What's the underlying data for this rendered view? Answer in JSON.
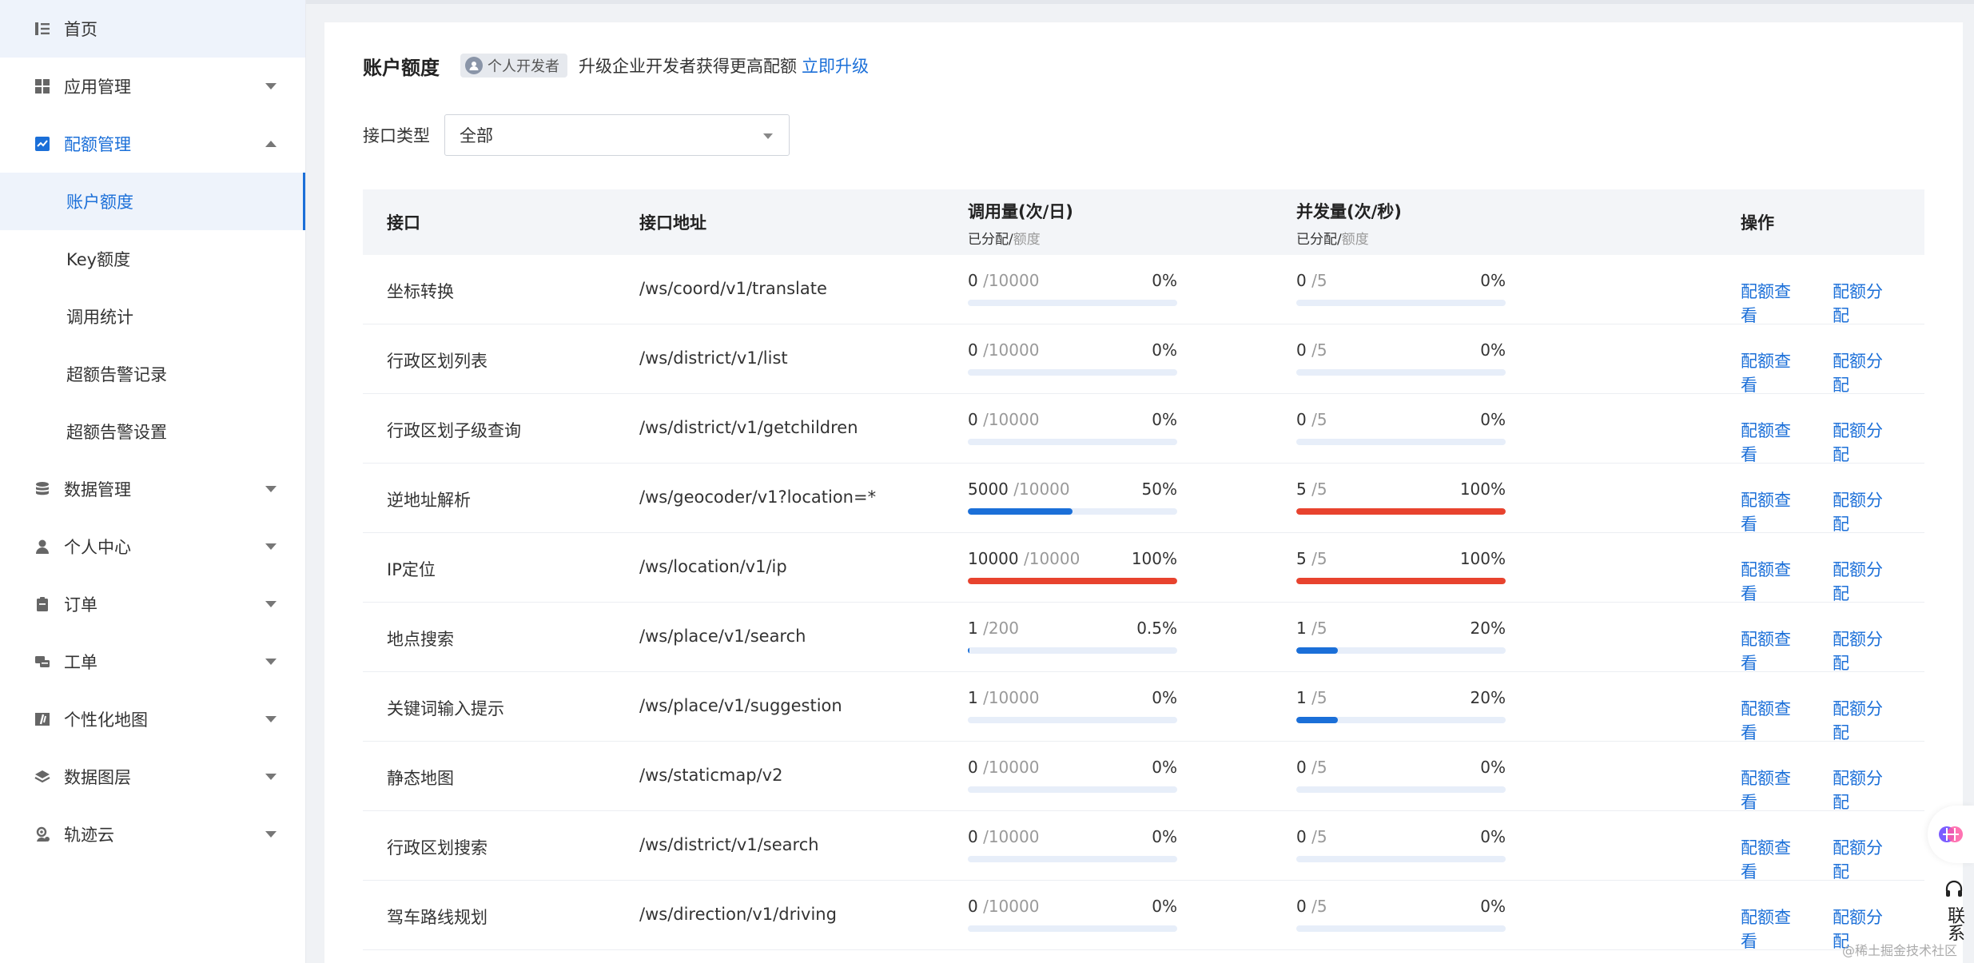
{
  "sidebar": {
    "items": [
      {
        "label": "首页",
        "icon": "list-icon",
        "kind": "top",
        "state": "home"
      },
      {
        "label": "应用管理",
        "icon": "grid-icon",
        "kind": "top",
        "arrow": "down"
      },
      {
        "label": "配额管理",
        "icon": "chart-icon",
        "kind": "top",
        "arrow": "up",
        "state": "open"
      },
      {
        "label": "账户额度",
        "kind": "sub",
        "state": "active"
      },
      {
        "label": "Key额度",
        "kind": "sub"
      },
      {
        "label": "调用统计",
        "kind": "sub"
      },
      {
        "label": "超额告警记录",
        "kind": "sub"
      },
      {
        "label": "超额告警设置",
        "kind": "sub"
      },
      {
        "label": "数据管理",
        "icon": "database-icon",
        "kind": "top",
        "arrow": "down"
      },
      {
        "label": "个人中心",
        "icon": "user-icon",
        "kind": "top",
        "arrow": "down"
      },
      {
        "label": "订单",
        "icon": "clipboard-icon",
        "kind": "top",
        "arrow": "down"
      },
      {
        "label": "工单",
        "icon": "chat-icon",
        "kind": "top",
        "arrow": "down"
      },
      {
        "label": "个性化地图",
        "icon": "map-style-icon",
        "kind": "top",
        "arrow": "down"
      },
      {
        "label": "数据图层",
        "icon": "layers-icon",
        "kind": "top",
        "arrow": "down"
      },
      {
        "label": "轨迹云",
        "icon": "location-user-icon",
        "kind": "top",
        "arrow": "down"
      }
    ]
  },
  "header": {
    "title": "账户额度",
    "badge": "个人开发者",
    "upgrade_text": "升级企业开发者获得更高配额",
    "upgrade_link": "立即升级"
  },
  "filter": {
    "label": "接口类型",
    "value": "全部"
  },
  "table": {
    "headers": {
      "name": "接口",
      "path": "接口地址",
      "call": "调用量(次/日)",
      "call_sub_used": "已分配/",
      "call_sub_quota": "额度",
      "conc": "并发量(次/秒)",
      "conc_sub_used": "已分配/",
      "conc_sub_quota": "额度",
      "ops": "操作"
    },
    "op_view": "配额查看",
    "op_assign": "配额分配",
    "rows": [
      {
        "name": "坐标转换",
        "path": "/ws/coord/v1/translate",
        "call_used": "0",
        "call_total": "/10000",
        "call_pct": "0%",
        "call_ratio": 0,
        "conc_used": "0",
        "conc_total": "/5",
        "conc_pct": "0%",
        "conc_ratio": 0
      },
      {
        "name": "行政区划列表",
        "path": "/ws/district/v1/list",
        "call_used": "0",
        "call_total": "/10000",
        "call_pct": "0%",
        "call_ratio": 0,
        "conc_used": "0",
        "conc_total": "/5",
        "conc_pct": "0%",
        "conc_ratio": 0
      },
      {
        "name": "行政区划子级查询",
        "path": "/ws/district/v1/getchildren",
        "call_used": "0",
        "call_total": "/10000",
        "call_pct": "0%",
        "call_ratio": 0,
        "conc_used": "0",
        "conc_total": "/5",
        "conc_pct": "0%",
        "conc_ratio": 0
      },
      {
        "name": "逆地址解析",
        "path": "/ws/geocoder/v1?location=*",
        "call_used": "5000",
        "call_total": "/10000",
        "call_pct": "50%",
        "call_ratio": 0.5,
        "conc_used": "5",
        "conc_total": "/5",
        "conc_pct": "100%",
        "conc_ratio": 1
      },
      {
        "name": "IP定位",
        "path": "/ws/location/v1/ip",
        "call_used": "10000",
        "call_total": "/10000",
        "call_pct": "100%",
        "call_ratio": 1,
        "conc_used": "5",
        "conc_total": "/5",
        "conc_pct": "100%",
        "conc_ratio": 1
      },
      {
        "name": "地点搜索",
        "path": "/ws/place/v1/search",
        "call_used": "1",
        "call_total": "/200",
        "call_pct": "0.5%",
        "call_ratio": 0.005,
        "conc_used": "1",
        "conc_total": "/5",
        "conc_pct": "20%",
        "conc_ratio": 0.2
      },
      {
        "name": "关键词输入提示",
        "path": "/ws/place/v1/suggestion",
        "call_used": "1",
        "call_total": "/10000",
        "call_pct": "0%",
        "call_ratio": 0,
        "conc_used": "1",
        "conc_total": "/5",
        "conc_pct": "20%",
        "conc_ratio": 0.2
      },
      {
        "name": "静态地图",
        "path": "/ws/staticmap/v2",
        "call_used": "0",
        "call_total": "/10000",
        "call_pct": "0%",
        "call_ratio": 0,
        "conc_used": "0",
        "conc_total": "/5",
        "conc_pct": "0%",
        "conc_ratio": 0
      },
      {
        "name": "行政区划搜索",
        "path": "/ws/district/v1/search",
        "call_used": "0",
        "call_total": "/10000",
        "call_pct": "0%",
        "call_ratio": 0,
        "conc_used": "0",
        "conc_total": "/5",
        "conc_pct": "0%",
        "conc_ratio": 0
      },
      {
        "name": "驾车路线规划",
        "path": "/ws/direction/v1/driving",
        "call_used": "0",
        "call_total": "/10000",
        "call_pct": "0%",
        "call_ratio": 0,
        "conc_used": "0",
        "conc_total": "/5",
        "conc_pct": "0%",
        "conc_ratio": 0
      }
    ]
  },
  "colors": {
    "accent": "#1b6fd8",
    "bar_normal": "#1b6fd8",
    "bar_full": "#e8432e",
    "bar_track": "#e7eef9"
  },
  "floating": {
    "contact": "联系",
    "watermark": "@稀土掘金技术社区"
  }
}
